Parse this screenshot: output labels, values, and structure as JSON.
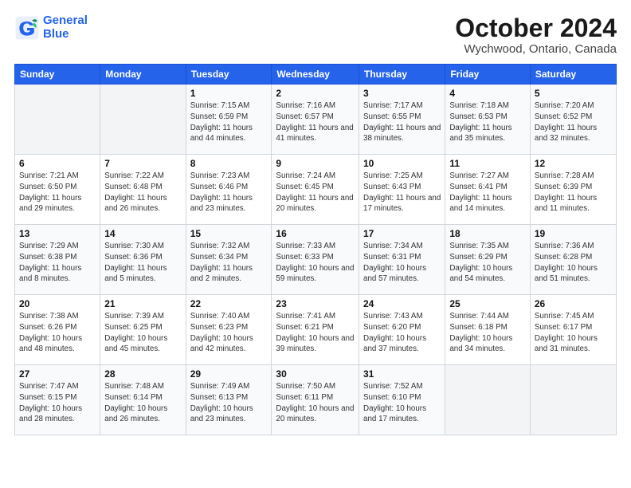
{
  "header": {
    "logo_line1": "General",
    "logo_line2": "Blue",
    "month": "October 2024",
    "location": "Wychwood, Ontario, Canada"
  },
  "weekdays": [
    "Sunday",
    "Monday",
    "Tuesday",
    "Wednesday",
    "Thursday",
    "Friday",
    "Saturday"
  ],
  "weeks": [
    [
      {
        "num": "",
        "info": "",
        "empty": true
      },
      {
        "num": "",
        "info": "",
        "empty": true
      },
      {
        "num": "1",
        "info": "Sunrise: 7:15 AM\nSunset: 6:59 PM\nDaylight: 11 hours and 44 minutes."
      },
      {
        "num": "2",
        "info": "Sunrise: 7:16 AM\nSunset: 6:57 PM\nDaylight: 11 hours and 41 minutes."
      },
      {
        "num": "3",
        "info": "Sunrise: 7:17 AM\nSunset: 6:55 PM\nDaylight: 11 hours and 38 minutes."
      },
      {
        "num": "4",
        "info": "Sunrise: 7:18 AM\nSunset: 6:53 PM\nDaylight: 11 hours and 35 minutes."
      },
      {
        "num": "5",
        "info": "Sunrise: 7:20 AM\nSunset: 6:52 PM\nDaylight: 11 hours and 32 minutes."
      }
    ],
    [
      {
        "num": "6",
        "info": "Sunrise: 7:21 AM\nSunset: 6:50 PM\nDaylight: 11 hours and 29 minutes."
      },
      {
        "num": "7",
        "info": "Sunrise: 7:22 AM\nSunset: 6:48 PM\nDaylight: 11 hours and 26 minutes."
      },
      {
        "num": "8",
        "info": "Sunrise: 7:23 AM\nSunset: 6:46 PM\nDaylight: 11 hours and 23 minutes."
      },
      {
        "num": "9",
        "info": "Sunrise: 7:24 AM\nSunset: 6:45 PM\nDaylight: 11 hours and 20 minutes."
      },
      {
        "num": "10",
        "info": "Sunrise: 7:25 AM\nSunset: 6:43 PM\nDaylight: 11 hours and 17 minutes."
      },
      {
        "num": "11",
        "info": "Sunrise: 7:27 AM\nSunset: 6:41 PM\nDaylight: 11 hours and 14 minutes."
      },
      {
        "num": "12",
        "info": "Sunrise: 7:28 AM\nSunset: 6:39 PM\nDaylight: 11 hours and 11 minutes."
      }
    ],
    [
      {
        "num": "13",
        "info": "Sunrise: 7:29 AM\nSunset: 6:38 PM\nDaylight: 11 hours and 8 minutes."
      },
      {
        "num": "14",
        "info": "Sunrise: 7:30 AM\nSunset: 6:36 PM\nDaylight: 11 hours and 5 minutes."
      },
      {
        "num": "15",
        "info": "Sunrise: 7:32 AM\nSunset: 6:34 PM\nDaylight: 11 hours and 2 minutes."
      },
      {
        "num": "16",
        "info": "Sunrise: 7:33 AM\nSunset: 6:33 PM\nDaylight: 10 hours and 59 minutes."
      },
      {
        "num": "17",
        "info": "Sunrise: 7:34 AM\nSunset: 6:31 PM\nDaylight: 10 hours and 57 minutes."
      },
      {
        "num": "18",
        "info": "Sunrise: 7:35 AM\nSunset: 6:29 PM\nDaylight: 10 hours and 54 minutes."
      },
      {
        "num": "19",
        "info": "Sunrise: 7:36 AM\nSunset: 6:28 PM\nDaylight: 10 hours and 51 minutes."
      }
    ],
    [
      {
        "num": "20",
        "info": "Sunrise: 7:38 AM\nSunset: 6:26 PM\nDaylight: 10 hours and 48 minutes."
      },
      {
        "num": "21",
        "info": "Sunrise: 7:39 AM\nSunset: 6:25 PM\nDaylight: 10 hours and 45 minutes."
      },
      {
        "num": "22",
        "info": "Sunrise: 7:40 AM\nSunset: 6:23 PM\nDaylight: 10 hours and 42 minutes."
      },
      {
        "num": "23",
        "info": "Sunrise: 7:41 AM\nSunset: 6:21 PM\nDaylight: 10 hours and 39 minutes."
      },
      {
        "num": "24",
        "info": "Sunrise: 7:43 AM\nSunset: 6:20 PM\nDaylight: 10 hours and 37 minutes."
      },
      {
        "num": "25",
        "info": "Sunrise: 7:44 AM\nSunset: 6:18 PM\nDaylight: 10 hours and 34 minutes."
      },
      {
        "num": "26",
        "info": "Sunrise: 7:45 AM\nSunset: 6:17 PM\nDaylight: 10 hours and 31 minutes."
      }
    ],
    [
      {
        "num": "27",
        "info": "Sunrise: 7:47 AM\nSunset: 6:15 PM\nDaylight: 10 hours and 28 minutes."
      },
      {
        "num": "28",
        "info": "Sunrise: 7:48 AM\nSunset: 6:14 PM\nDaylight: 10 hours and 26 minutes."
      },
      {
        "num": "29",
        "info": "Sunrise: 7:49 AM\nSunset: 6:13 PM\nDaylight: 10 hours and 23 minutes."
      },
      {
        "num": "30",
        "info": "Sunrise: 7:50 AM\nSunset: 6:11 PM\nDaylight: 10 hours and 20 minutes."
      },
      {
        "num": "31",
        "info": "Sunrise: 7:52 AM\nSunset: 6:10 PM\nDaylight: 10 hours and 17 minutes."
      },
      {
        "num": "",
        "info": "",
        "empty": true
      },
      {
        "num": "",
        "info": "",
        "empty": true
      }
    ]
  ]
}
